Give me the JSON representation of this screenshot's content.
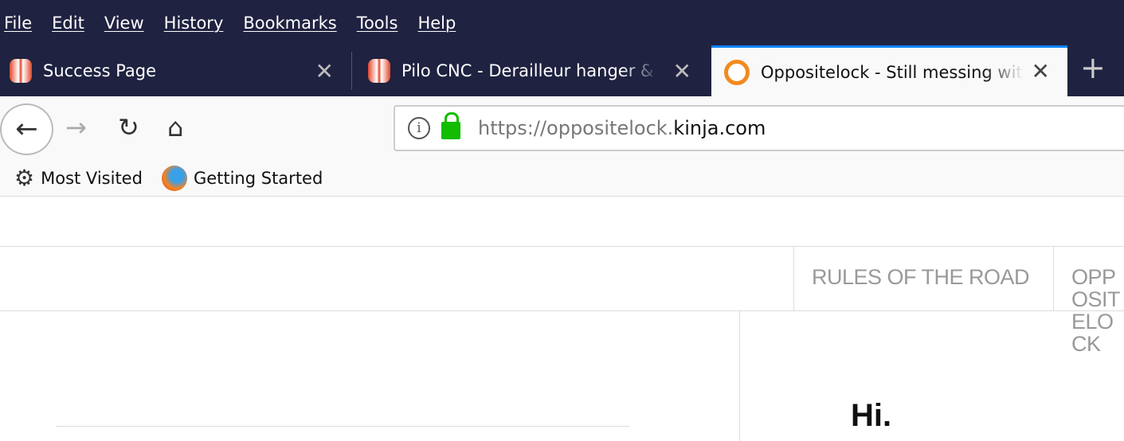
{
  "menu": [
    "File",
    "Edit",
    "View",
    "History",
    "Bookmarks",
    "Tools",
    "Help"
  ],
  "tabs": [
    {
      "title": "Success Page",
      "icon": "magento-icon"
    },
    {
      "title": "Pilo CNC - Derailleur hanger & ",
      "icon": "magento-icon"
    },
    {
      "title": "Oppositelock - Still messing with",
      "icon": "oppositelock-icon",
      "active": true
    }
  ],
  "url": {
    "prefix": "https://oppositelock.",
    "domain": "kinja.com"
  },
  "bookmarks": [
    "Most Visited",
    "Getting Started"
  ],
  "page": {
    "nav": [
      "RULES OF THE ROAD",
      "OPPOSITELOCK"
    ],
    "greeting": "Hi."
  },
  "colors": {
    "chrome": "#1f2240",
    "accent": "#0a84ff",
    "lock": "#12bc00"
  }
}
